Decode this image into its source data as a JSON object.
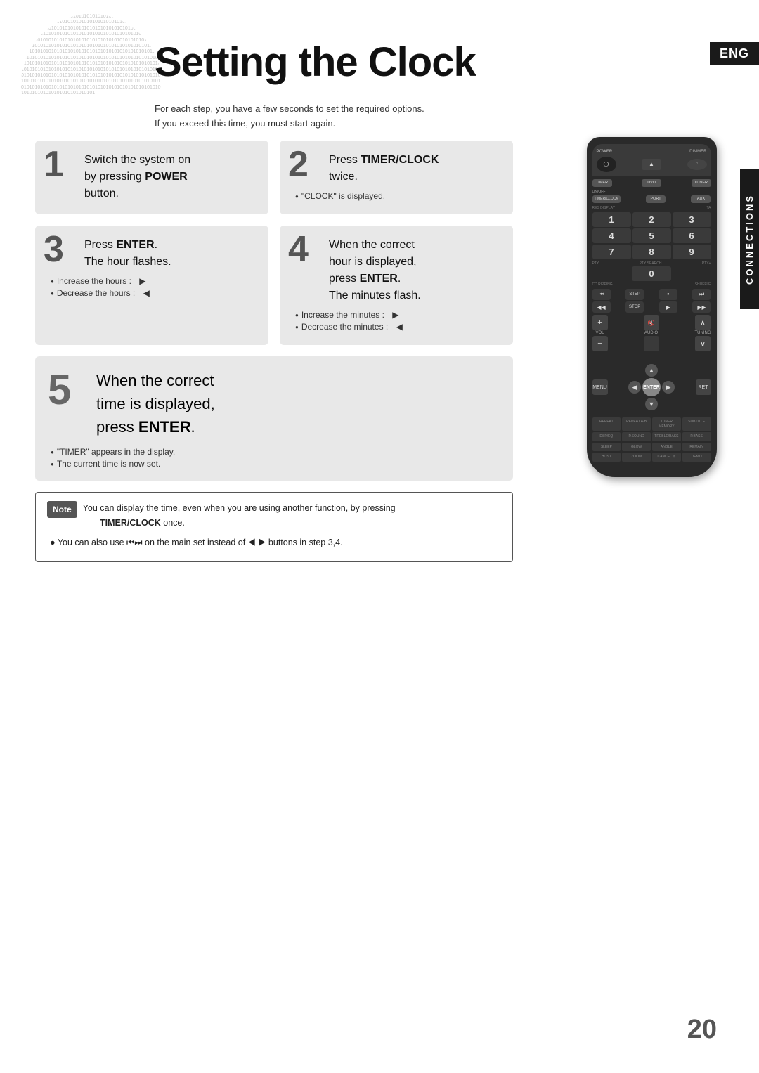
{
  "page": {
    "title": "Setting the Clock",
    "eng_badge": "ENG",
    "connections_label": "CONNECTIONS",
    "page_number": "20",
    "subtitle_line1": "For each step, you have a few seconds to set the required options.",
    "subtitle_line2": "If you exceed this time, you must start again."
  },
  "steps": {
    "step1": {
      "number": "1",
      "text_line1": "Switch the system on",
      "text_line2": "by pressing ",
      "text_bold": "POWER",
      "text_line3": "button."
    },
    "step2": {
      "number": "2",
      "text_line1": "Press ",
      "text_bold": "TIMER/CLOCK",
      "text_line2": "twice.",
      "note": "\"CLOCK\" is displayed."
    },
    "step3": {
      "number": "3",
      "text_line1": "Press ",
      "text_bold": "ENTER",
      "text_line2": ".",
      "text_line3": "The hour flashes.",
      "note1": "Increase the hours :",
      "note2": "Decrease the hours :"
    },
    "step4": {
      "number": "4",
      "text_line1": "When the correct",
      "text_line2": "hour is displayed,",
      "text_line3": "press ",
      "text_bold": "ENTER",
      "text_line4": ".",
      "text_line5": "The minutes flash.",
      "note1": "Increase the minutes :",
      "note2": "Decrease the minutes :"
    },
    "step5": {
      "number": "5",
      "text_line1": "When the correct",
      "text_line2": "time is displayed,",
      "text_line3": "press ",
      "text_bold": "ENTER",
      "text_line4": ".",
      "note1": "\"TIMER\" appears in the display.",
      "note2": "The current time is now set."
    }
  },
  "note_box": {
    "label": "Note",
    "line1": "You can display the time, even when you are using another function, by pressing",
    "line1_bold": "TIMER/CLOCK",
    "line1_end": "once.",
    "line2_start": "You can also use ",
    "line2_mid": "on the main set instead of",
    "line2_end": "buttons in step 3,4."
  },
  "remote": {
    "power_label": "POWER",
    "dimmer_label": "DIMMER",
    "eject_symbol": "▲",
    "timer_label": "TIMER",
    "on_off_label": "ON/OFF",
    "dvd_label": "DVD",
    "tuner_label": "TUNER",
    "timer_clock_label": "TIMER/CLOCK",
    "port_label": "PORT",
    "aux_label": "AUX",
    "num_buttons": [
      "1",
      "2",
      "3",
      "4",
      "5",
      "6",
      "7",
      "8",
      "9",
      "0"
    ],
    "enter_label": "ENTER"
  },
  "binary_text": "010101010101010101010101010101010101010101010101010101010101010101010101010101010101010101010101010101010101010101010101010101010101010101010101010101010101010101010101010101010101010101010101010101010101010101010101010101010101010101010101010101010101010101010101010101010101010101010101010101010101010101010101010101010101010101010101010101010101010101010101010101010101010101010101010101010101010101010101010101010101010101010101010101010101010101010101010101010101010101010101010101010101010101010101010101010101010101010101010101010101010101010101010101010101010101010101010101010101010101010101010101010101010101010101010101010101010101010101010101010101010101010101010101010101010101"
}
